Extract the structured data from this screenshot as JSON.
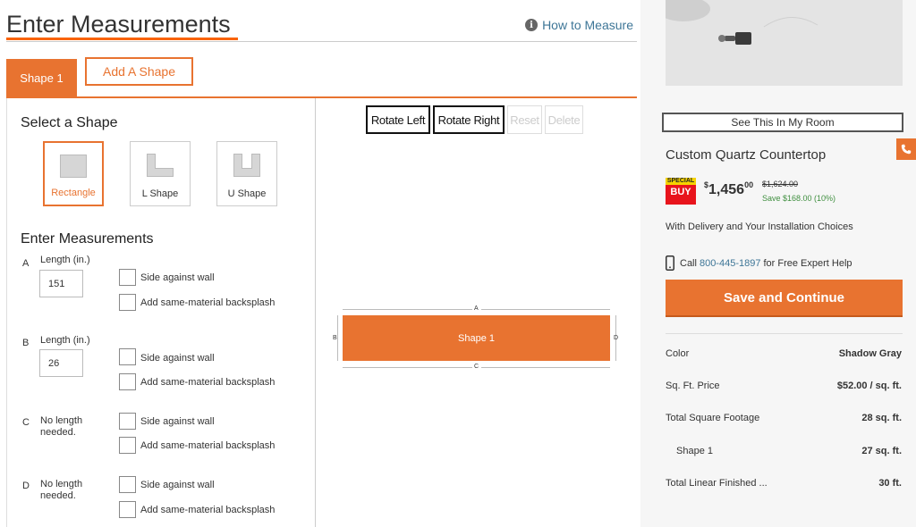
{
  "header": {
    "title": "Enter Measurements",
    "how_to_measure": "How to Measure",
    "info_icon": "info-icon"
  },
  "tabs": {
    "active": "Shape 1",
    "add": "Add A Shape"
  },
  "form": {
    "select_shape_title": "Select a Shape",
    "shapes": [
      {
        "label": "Rectangle",
        "icon": "rectangle-icon",
        "selected": true
      },
      {
        "label": "L Shape",
        "icon": "l-shape-icon",
        "selected": false
      },
      {
        "label": "U Shape",
        "icon": "u-shape-icon",
        "selected": false
      }
    ],
    "measurements_title": "Enter Measurements",
    "rows": [
      {
        "letter": "A",
        "label": "Length (in.)",
        "value": "151",
        "wall": "Side against wall",
        "backsplash": "Add same-material backsplash"
      },
      {
        "letter": "B",
        "label": "Length (in.)",
        "value": "26",
        "wall": "Side against wall",
        "backsplash": "Add same-material backsplash"
      },
      {
        "letter": "C",
        "label": "No length needed.",
        "value": "",
        "wall": "Side against wall",
        "backsplash": "Add same-material backsplash"
      },
      {
        "letter": "D",
        "label": "No length needed.",
        "value": "",
        "wall": "Side against wall",
        "backsplash": "Add same-material backsplash"
      }
    ]
  },
  "canvas": {
    "buttons": {
      "rotate_left": "Rotate Left",
      "rotate_right": "Rotate Right",
      "reset": "Reset",
      "delete": "Delete"
    },
    "shape_label": "Shape 1",
    "dims": {
      "top": "A",
      "left": "B",
      "bottom": "C",
      "right": "D"
    }
  },
  "sidebar": {
    "see_in_room": "See This In My Room",
    "product_title": "Custom Quartz Countertop",
    "badge_top": "SPECIAL",
    "badge_bottom": "BUY",
    "price_dollars": "$",
    "price_main": "1,456",
    "price_cents": "00",
    "price_old": "$1,624.00",
    "price_save": "Save $168.00 (10%)",
    "delivery": "With Delivery and Your Installation Choices",
    "call_prefix": "Call",
    "call_number": "800-445-1897",
    "call_suffix": "for Free Expert Help",
    "save_continue": "Save and Continue",
    "specs": [
      {
        "label": "Color",
        "value": "Shadow Gray"
      },
      {
        "label": "Sq. Ft. Price",
        "value": "$52.00 / sq. ft."
      },
      {
        "label": "Total Square Footage",
        "value": "28 sq. ft."
      },
      {
        "label": "Shape 1",
        "value": "27 sq. ft."
      },
      {
        "label": "Total Linear Finished ...",
        "value": "30 ft."
      }
    ]
  },
  "colors": {
    "accent": "#e87330",
    "link": "#3e7697",
    "save_green": "#3f8f3f"
  }
}
